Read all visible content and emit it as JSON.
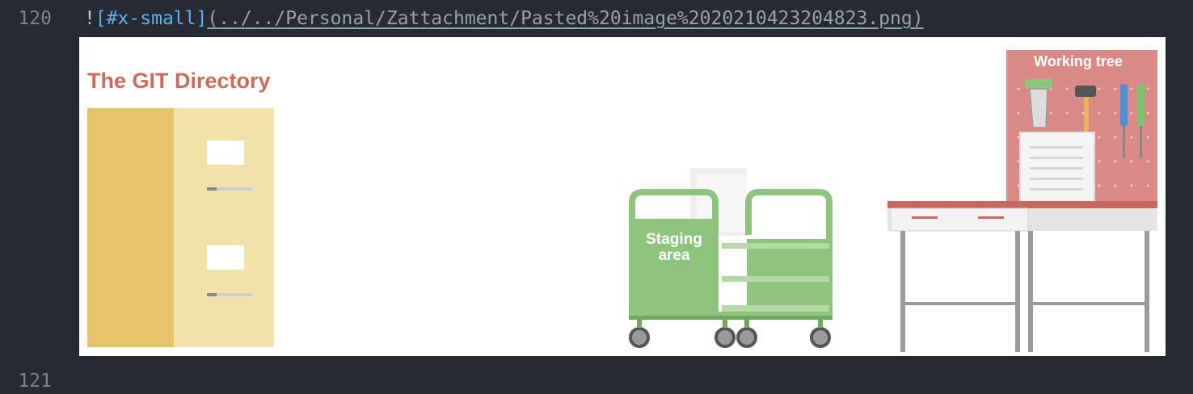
{
  "editor": {
    "line_120": "120",
    "line_121": "121",
    "markdown": {
      "bang": "!",
      "alt_text": "[#x-small]",
      "path": "(../../Personal/Zattachment/Pasted%20image%2020210423204823.png)"
    }
  },
  "image": {
    "git_directory_label": "The GIT Directory",
    "staging_label_line1": "Staging",
    "staging_label_line2": "area",
    "working_tree_label": "Working tree"
  },
  "colors": {
    "editor_bg": "#262a33",
    "link_blue": "#61afef",
    "git_label": "#cc6b58",
    "cabinet_dark": "#e5c36b",
    "cabinet_light": "#f1e2aa",
    "cart_green": "#8fc47f",
    "cart_green_dark": "#6ea85e",
    "pegboard_red": "#d98a86",
    "table_red": "#c7695f"
  }
}
